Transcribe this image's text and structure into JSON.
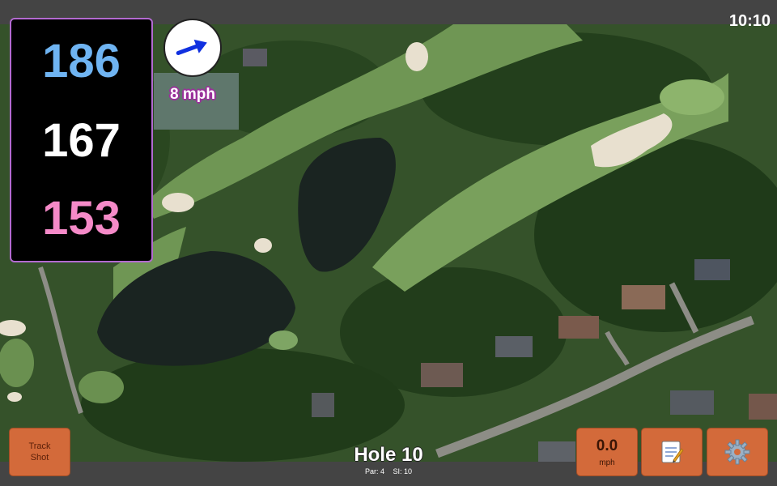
{
  "clock": "10:10",
  "distances": {
    "back": "186",
    "middle": "167",
    "front": "153",
    "back_color": "#6fb4f2",
    "middle_color": "#ffffff",
    "front_color": "#f58ac8"
  },
  "wind": {
    "speed_label": "8 mph",
    "arrow_icon": "arrow-right-icon",
    "arrow_color": "#1030e0"
  },
  "buttons": {
    "track_shot": "Track Shot",
    "wind_value": "0.0",
    "wind_unit": "mph",
    "notes_icon": "notepad-icon",
    "settings_icon": "gear-icon",
    "accent": "#d36a3a"
  },
  "hole": {
    "title": "Hole 10",
    "par": "Par: 4",
    "si": "SI: 10"
  }
}
